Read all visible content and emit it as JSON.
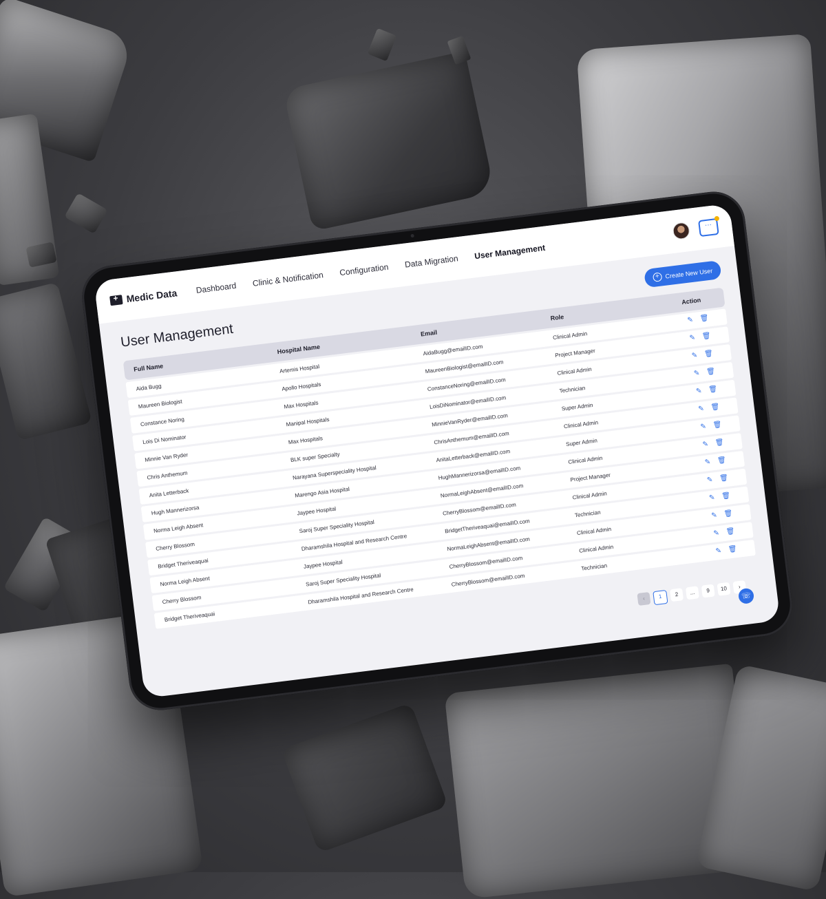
{
  "brand": {
    "name": "Medic Data"
  },
  "nav": {
    "items": [
      {
        "label": "Dashboard"
      },
      {
        "label": "Clinic & Notification"
      },
      {
        "label": "Configuration"
      },
      {
        "label": "Data Migration"
      },
      {
        "label": "User Management",
        "active": true
      }
    ]
  },
  "page": {
    "title": "User Management",
    "create_label": "Create New User"
  },
  "table": {
    "columns": [
      "Full Name",
      "Hospital Name",
      "Email",
      "Role",
      "Action"
    ],
    "rows": [
      {
        "name": "Aida Bugg",
        "hospital": "Artemis Hospital",
        "email": "AidaBugg@emailID.com",
        "role": "Clinical Admin"
      },
      {
        "name": "Maureen Biologist",
        "hospital": "Apollo Hospitals",
        "email": "MaureenBiologist@emailID.com",
        "role": "Project Manager"
      },
      {
        "name": "Constance Noring",
        "hospital": "Max Hospitals",
        "email": "ConstanceNoring@emailID.com",
        "role": "Clinical Admin"
      },
      {
        "name": "Lois Di Nominator",
        "hospital": "Manipal Hospitals",
        "email": "LoisDiNominator@emailID.com",
        "role": "Technician"
      },
      {
        "name": "Minnie Van Ryder",
        "hospital": "Max Hospitals",
        "email": "MinnieVanRyder@emailID.com",
        "role": "Super Admin"
      },
      {
        "name": "Chris Anthemum",
        "hospital": "BLK super Specialty",
        "email": "ChrisAnthemum@emailID.com",
        "role": "Clinical Admin"
      },
      {
        "name": "Anita Letterback",
        "hospital": "Narayana Superspeciality Hospital",
        "email": "AnitaLetterback@emailID.com",
        "role": "Super Admin"
      },
      {
        "name": "Hugh Mannerizorsa",
        "hospital": "Marengo Asia Hospital",
        "email": "HughMannerizorsa@emailID.com",
        "role": "Clinical Admin"
      },
      {
        "name": "Norma Leigh Absent",
        "hospital": "Jaypee Hospital",
        "email": "NormaLeighAbsent@emailID.com",
        "role": "Project Manager"
      },
      {
        "name": "Cherry Blossom",
        "hospital": "Saroj Super Speciality Hospital",
        "email": "CherryBlossom@emailID.com",
        "role": "Clinical Admin"
      },
      {
        "name": "Bridget Theriveaquai",
        "hospital": "Dharamshila Hospital and  Research Centre",
        "email": "BridgetTheriveaquai@emailID.com",
        "role": "Technician"
      },
      {
        "name": "Norma Leigh Absent",
        "hospital": "Jaypee Hospital",
        "email": "NormaLeighAbsent@emailID.com",
        "role": "Clinical Admin"
      },
      {
        "name": "Cherry Blossom",
        "hospital": "Saroj Super Speciality Hospital",
        "email": "CherryBlossom@emailID.com",
        "role": "Clinical Admin"
      },
      {
        "name": "Bridget Theriveaquai",
        "hospital": "Dharamshila Hospital and  Research Centre",
        "email": "CherryBlossom@emailID.com",
        "role": "Technician"
      }
    ]
  },
  "pagination": {
    "prev": "‹",
    "pages": [
      "1",
      "2",
      "...",
      "9",
      "10"
    ],
    "current": "1",
    "next": "›"
  },
  "icons": {
    "edit": "edit-icon",
    "delete": "trash-icon",
    "chat": "chat-icon",
    "support": "support-icon",
    "add": "plus-icon"
  },
  "colors": {
    "accent": "#2f6fe6",
    "notification": "#f5b300",
    "header": "#d9d9e3"
  }
}
